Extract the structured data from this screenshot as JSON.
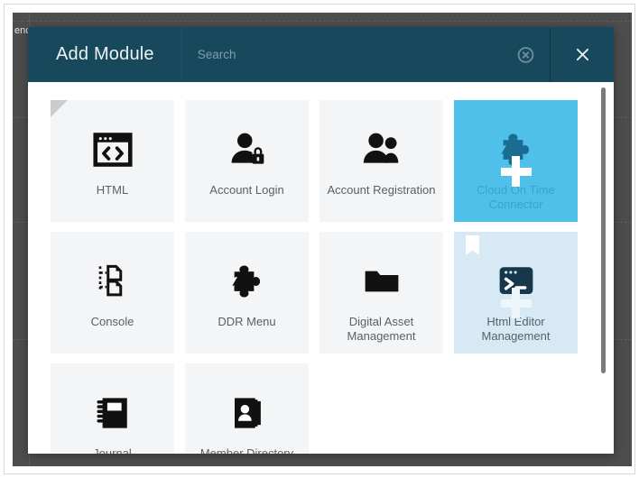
{
  "backdrop": {
    "edge_text": "enc",
    "color": "#4d4d4d"
  },
  "modal": {
    "title": "Add Module",
    "header_color": "#17485c",
    "search": {
      "placeholder": "Search",
      "value": "",
      "clear_icon": "circle-x-icon"
    },
    "close_label": "close-icon"
  },
  "colors": {
    "header": "#17485c",
    "tile": "#f4f5f7",
    "tile_hover": "#4fc0ea",
    "tile_selected": "#d6e9f5",
    "label": "#5a6066",
    "backdrop": "#4d4d4d"
  },
  "tiles": [
    {
      "label": "HTML",
      "icon": "code-window-icon",
      "state": "flagged"
    },
    {
      "label": "Account Login",
      "icon": "user-lock-icon",
      "state": "normal"
    },
    {
      "label": "Account Registration",
      "icon": "users-icon",
      "state": "normal"
    },
    {
      "label": "Cloud On Time Connector",
      "icon": "puzzle-piece-icon",
      "state": "hover"
    },
    {
      "label": "Console",
      "icon": "console-tree-icon",
      "state": "normal"
    },
    {
      "label": "DDR Menu",
      "icon": "puzzle-piece-icon",
      "state": "normal"
    },
    {
      "label": "Digital Asset Management",
      "icon": "folder-icon",
      "state": "normal"
    },
    {
      "label": "Html Editor Management",
      "icon": "terminal-icon",
      "state": "selected"
    },
    {
      "label": "Journal",
      "icon": "notebook-icon",
      "state": "normal"
    },
    {
      "label": "Member Directory",
      "icon": "address-book-icon",
      "state": "normal"
    }
  ],
  "scrollbar": {
    "orientation": "vertical",
    "thumb_position": "top"
  }
}
